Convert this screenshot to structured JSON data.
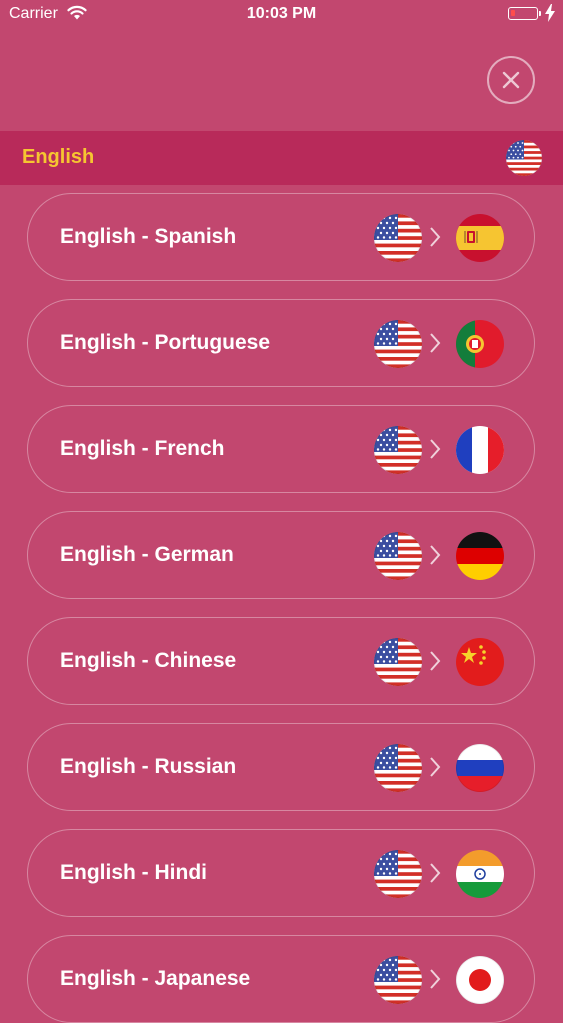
{
  "status_bar": {
    "carrier": "Carrier",
    "time": "10:03 PM"
  },
  "header": {
    "title": "English",
    "flag": "us-flag-icon"
  },
  "pairs": [
    {
      "label": "English - Spanish",
      "from_flag": "us-flag-icon",
      "to_flag": "spain-flag-icon"
    },
    {
      "label": "English - Portuguese",
      "from_flag": "us-flag-icon",
      "to_flag": "portugal-flag-icon"
    },
    {
      "label": "English - French",
      "from_flag": "us-flag-icon",
      "to_flag": "france-flag-icon"
    },
    {
      "label": "English - German",
      "from_flag": "us-flag-icon",
      "to_flag": "germany-flag-icon"
    },
    {
      "label": "English - Chinese",
      "from_flag": "us-flag-icon",
      "to_flag": "china-flag-icon"
    },
    {
      "label": "English - Russian",
      "from_flag": "us-flag-icon",
      "to_flag": "russia-flag-icon"
    },
    {
      "label": "English - Hindi",
      "from_flag": "us-flag-icon",
      "to_flag": "india-flag-icon"
    },
    {
      "label": "English - Japanese",
      "from_flag": "us-flag-icon",
      "to_flag": "japan-flag-icon"
    }
  ],
  "colors": {
    "background": "#c2476f",
    "header_bar": "#b82a5a",
    "header_text": "#f6c531"
  }
}
